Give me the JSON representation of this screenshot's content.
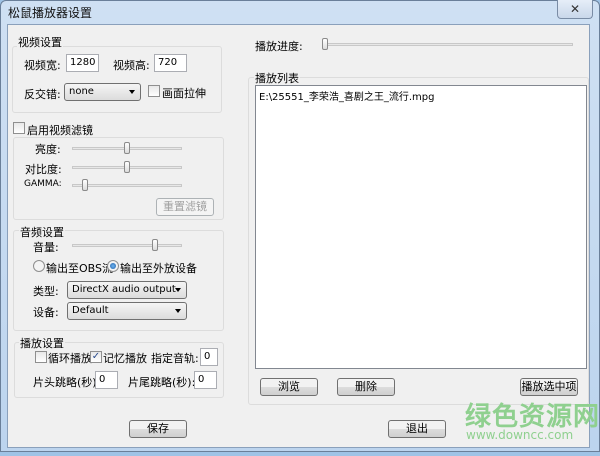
{
  "window": {
    "title": "松鼠播放器设置",
    "close_icon": "close-icon"
  },
  "video": {
    "group": "视频设置",
    "width_label": "视频宽:",
    "width_value": "1280",
    "height_label": "视频高:",
    "height_value": "720",
    "deinterlace_label": "反交错:",
    "deinterlace_value": "none",
    "stretch_label": "画面拉伸",
    "stretch_checked": false
  },
  "filter": {
    "enable_label": "启用视频滤镜",
    "enabled": false,
    "brightness_label": "亮度:",
    "brightness": 0.5,
    "contrast_label": "对比度:",
    "contrast": 0.5,
    "gamma_label": "GAMMA:",
    "gamma": 0.1,
    "reset_label": "重置滤镜"
  },
  "audio": {
    "group": "音频设置",
    "volume_label": "音量:",
    "volume": 0.75,
    "radio_obs": "输出至OBS流",
    "radio_external": "输出至外放设备",
    "selected": "external",
    "type_label": "类型:",
    "type_value": "DirectX audio output",
    "device_label": "设备:",
    "device_value": "Default"
  },
  "playback": {
    "group": "播放设置",
    "loop_label": "循环播放",
    "loop": false,
    "memory_label": "记忆播放",
    "memory": true,
    "track_label": "指定音轨:",
    "track_value": "0",
    "head_skip_label": "片头跳略(秒):",
    "head_skip_value": "0",
    "tail_skip_label": "片尾跳略(秒):",
    "tail_skip_value": "0"
  },
  "progress": {
    "label": "播放进度:",
    "value": 0
  },
  "playlist": {
    "group": "播放列表",
    "items": [
      "E:\\25551_李荣浩_喜剧之王_流行.mpg"
    ],
    "browse": "浏览",
    "delete": "删除",
    "play_selected": "播放选中项"
  },
  "footer": {
    "save": "保存",
    "exit": "退出"
  },
  "watermark": {
    "name": "绿色资源网",
    "url": "www.downcc.com"
  }
}
